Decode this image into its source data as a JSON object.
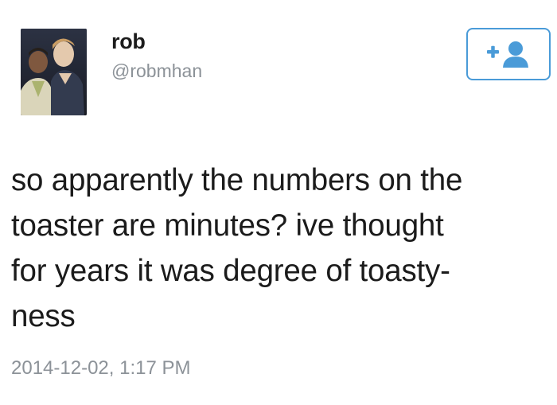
{
  "user": {
    "display_name": "rob",
    "handle": "@robmhan"
  },
  "follow_button": {
    "icon": "add-user-icon",
    "color": "#4a9bd8"
  },
  "tweet": {
    "lines": [
      "so apparently the numbers on the",
      "toaster are minutes? ive thought",
      "for years it was degree of toasty-",
      "ness"
    ],
    "timestamp": "2014-12-02, 1:17 PM"
  }
}
